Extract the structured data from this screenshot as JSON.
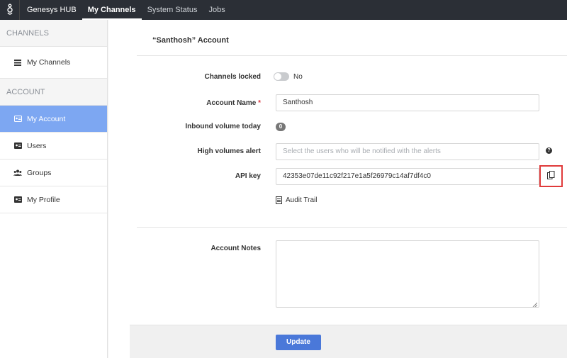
{
  "topnav": {
    "brand": "Genesys HUB",
    "items": [
      "My Channels",
      "System Status",
      "Jobs"
    ],
    "active": "My Channels"
  },
  "sidebar": {
    "sections": [
      {
        "header": "CHANNELS",
        "items": [
          {
            "label": "My Channels",
            "icon": "list-icon"
          }
        ]
      },
      {
        "header": "ACCOUNT",
        "items": [
          {
            "label": "My Account",
            "icon": "id-card-icon",
            "active": true
          },
          {
            "label": "Users",
            "icon": "id-card-icon"
          },
          {
            "label": "Groups",
            "icon": "group-icon"
          },
          {
            "label": "My Profile",
            "icon": "id-card-icon"
          }
        ]
      }
    ]
  },
  "account": {
    "title": "“Santhosh” Account",
    "channels_locked_label": "Channels locked",
    "channels_locked_value": "No",
    "account_name_label": "Account Name",
    "required_mark": "*",
    "account_name_value": "Santhosh",
    "inbound_label": "Inbound volume today",
    "inbound_count": "0",
    "high_volumes_label": "High volumes alert",
    "high_volumes_placeholder": "Select the users who will be notified with the alerts",
    "help_glyph": "?",
    "api_key_label": "API key",
    "api_key_value": "42353e07de11c92f217e1a5f26979c14af7df4c0",
    "audit_trail": "Audit Trail",
    "notes_label": "Account Notes",
    "notes_value": "",
    "update_button": "Update"
  },
  "colors": {
    "topbar": "#2b2f36",
    "sidebar_active": "#7da7f2",
    "primary_button": "#4a78d9",
    "highlight_box": "#e03a3a"
  }
}
